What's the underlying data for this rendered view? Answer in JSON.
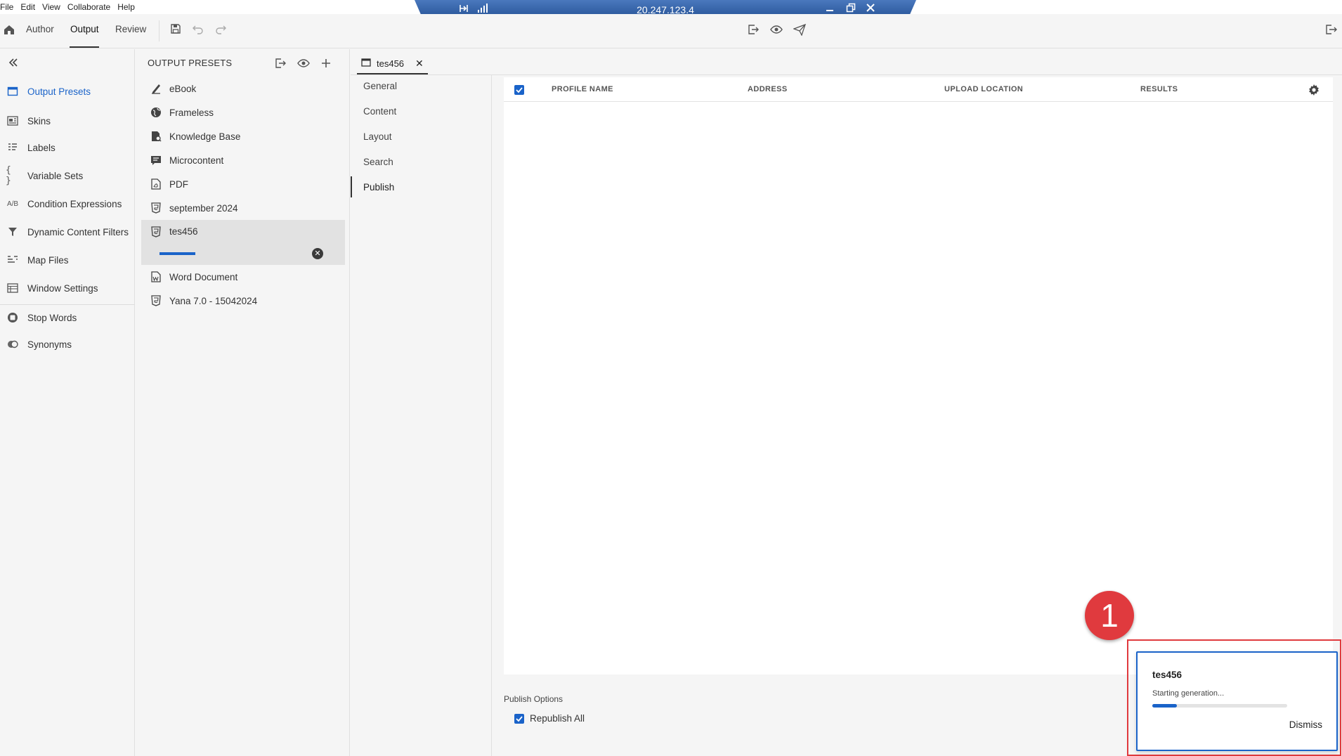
{
  "menu": [
    "File",
    "Edit",
    "View",
    "Collaborate",
    "Help"
  ],
  "remote": {
    "ip": "20.247.123.4"
  },
  "toolbar": {
    "tabs": [
      "Author",
      "Output",
      "Review"
    ],
    "active_tab": "Output"
  },
  "leftnav": {
    "items": [
      {
        "label": "Output Presets",
        "icon": "output-presets-icon",
        "active": true
      },
      {
        "label": "Skins",
        "icon": "skins-icon"
      },
      {
        "label": "Labels",
        "icon": "labels-icon"
      },
      {
        "label": "Variable Sets",
        "icon": "variable-sets-icon",
        "glyph": "{ }"
      },
      {
        "label": "Condition Expressions",
        "icon": "condition-expressions-icon",
        "glyph": "A/B"
      },
      {
        "label": "Dynamic Content Filters",
        "icon": "filter-icon"
      },
      {
        "label": "Map Files",
        "icon": "map-files-icon"
      },
      {
        "label": "Window Settings",
        "icon": "window-settings-icon"
      },
      {
        "label": "Stop Words",
        "icon": "stop-words-icon"
      },
      {
        "label": "Synonyms",
        "icon": "synonyms-icon"
      }
    ]
  },
  "presets": {
    "title": "OUTPUT PRESETS",
    "items": [
      {
        "label": "eBook",
        "icon": "ebook-icon"
      },
      {
        "label": "Frameless",
        "icon": "globe-icon"
      },
      {
        "label": "Knowledge Base",
        "icon": "knowledge-base-icon"
      },
      {
        "label": "Microcontent",
        "icon": "microcontent-icon"
      },
      {
        "label": "PDF",
        "icon": "pdf-icon"
      },
      {
        "label": "september 2024",
        "icon": "html5-icon"
      },
      {
        "label": "tes456",
        "icon": "html5-icon",
        "selected": true,
        "progress": 0.23
      },
      {
        "label": "Word Document",
        "icon": "word-icon"
      },
      {
        "label": "Yana 7.0 - 15042024",
        "icon": "html5-icon"
      }
    ]
  },
  "editor": {
    "tab_label": "tes456",
    "subnav": [
      "General",
      "Content",
      "Layout",
      "Search",
      "Publish"
    ],
    "active_subnav": "Publish",
    "columns": [
      "PROFILE NAME",
      "ADDRESS",
      "UPLOAD LOCATION",
      "RESULTS"
    ],
    "publish_options_label": "Publish Options",
    "republish_all_label": "Republish All",
    "republish_checked": true
  },
  "annotation": {
    "number": "1"
  },
  "notification": {
    "title": "tes456",
    "status": "Starting generation...",
    "progress": 0.18,
    "dismiss_label": "Dismiss"
  },
  "colors": {
    "accent": "#1a63c9",
    "annotation": "#e03a3e",
    "remote_bar": "#2d5fa3"
  }
}
